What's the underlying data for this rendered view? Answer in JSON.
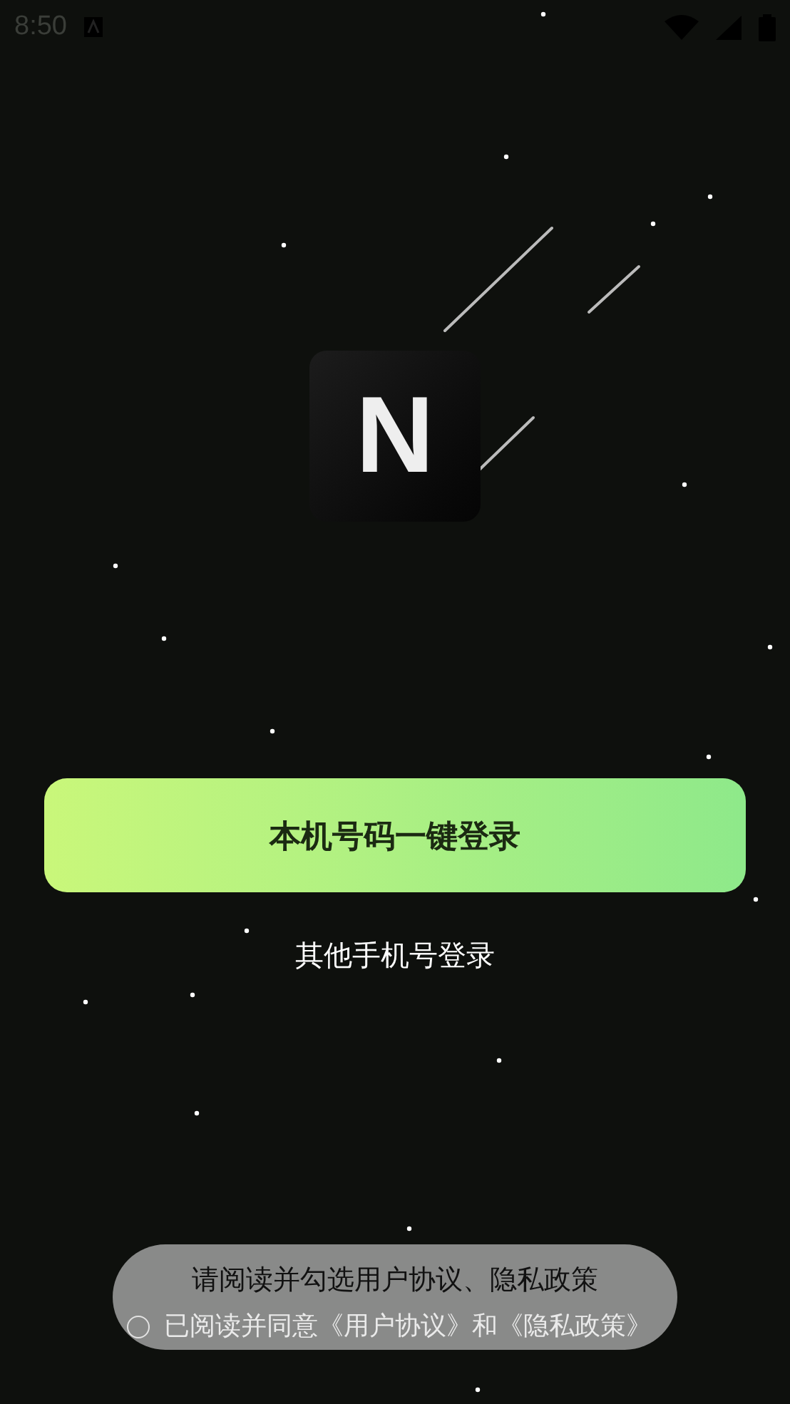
{
  "status_bar": {
    "time": "8:50"
  },
  "logo": {
    "letter": "N"
  },
  "primary_button": {
    "label": "本机号码一键登录"
  },
  "secondary_link": {
    "label": "其他手机号登录"
  },
  "agreement": {
    "checked": false,
    "text": "已阅读并同意《用户协议》和《隐私政策》"
  },
  "toast": {
    "message": "请阅读并勾选用户协议、隐私政策"
  }
}
